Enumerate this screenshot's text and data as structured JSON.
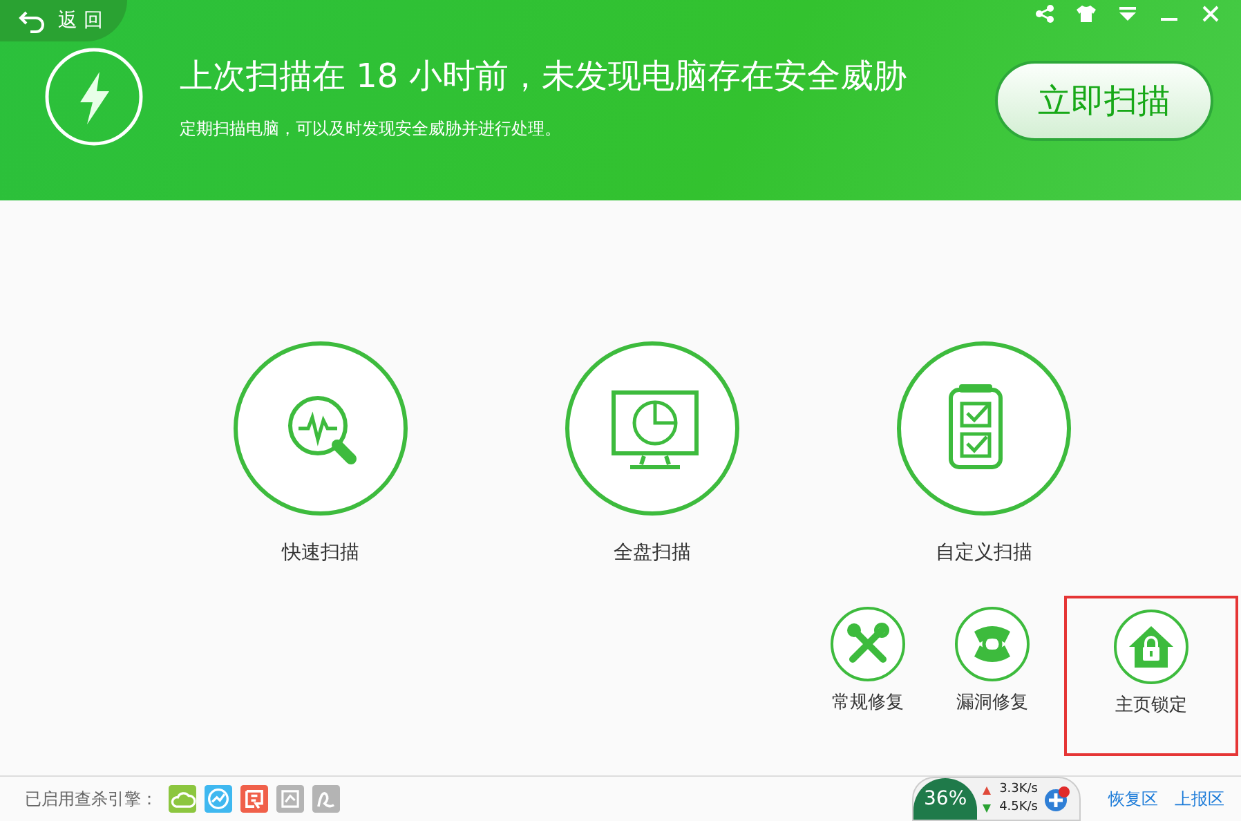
{
  "back_button": {
    "label": "返 回"
  },
  "window_controls": [
    {
      "kind": "share"
    },
    {
      "kind": "skin"
    },
    {
      "kind": "menu"
    },
    {
      "kind": "minimize"
    },
    {
      "kind": "close"
    }
  ],
  "header": {
    "title": "上次扫描在 18 小时前，未发现电脑存在安全威胁",
    "subtitle": "定期扫描电脑，可以及时发现安全威胁并进行处理。",
    "scan_button": "立即扫描"
  },
  "scan_modes": [
    {
      "kind": "quick",
      "label": "快速扫描"
    },
    {
      "kind": "full",
      "label": "全盘扫描"
    },
    {
      "kind": "custom",
      "label": "自定义扫描"
    }
  ],
  "tools": [
    {
      "kind": "repair",
      "label": "常规修复",
      "highlighted": false
    },
    {
      "kind": "patch",
      "label": "漏洞修复",
      "highlighted": false
    },
    {
      "kind": "lock",
      "label": "主页锁定",
      "highlighted": true
    }
  ],
  "status_bar": {
    "engines_label": "已启用查杀引擎：",
    "engines": [
      {
        "kind": "cloud",
        "enabled": true,
        "color": "#8cc63f"
      },
      {
        "kind": "wave",
        "enabled": true,
        "color": "#3fb8f0"
      },
      {
        "kind": "doc",
        "enabled": true,
        "color": "#f0604a"
      },
      {
        "kind": "chart",
        "enabled": false,
        "color": "#a8a8a8"
      },
      {
        "kind": "curve",
        "enabled": false,
        "color": "#a8a8a8"
      }
    ],
    "usage": "36%",
    "upload": "3.3K/s",
    "download": "4.5K/s",
    "links": [
      "恢复区",
      "上报区"
    ]
  }
}
